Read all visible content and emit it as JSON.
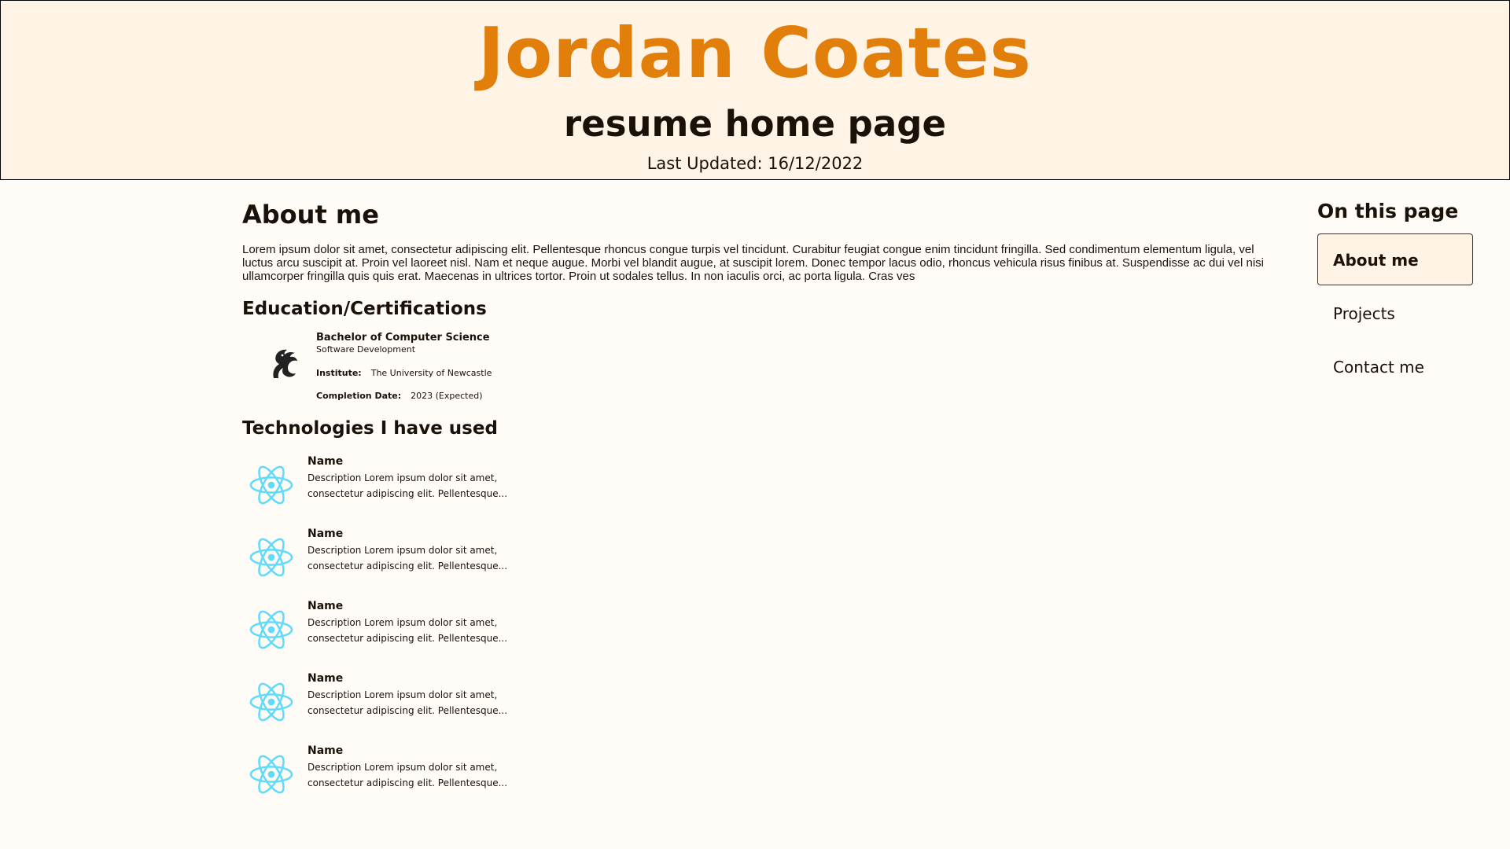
{
  "header": {
    "name": "Jordan Coates",
    "subtitle": "resume home page",
    "last_updated": "Last Updated: 16/12/2022"
  },
  "about": {
    "heading": "About me",
    "text": "Lorem ipsum dolor sit amet, consectetur adipiscing elit. Pellentesque rhoncus congue turpis vel tincidunt. Curabitur feugiat congue enim tincidunt fringilla. Sed condimentum elementum ligula, vel luctus arcu suscipit at. Proin vel laoreet nisl. Nam et neque augue. Morbi vel blandit augue, at suscipit lorem. Donec tempor lacus odio, rhoncus vehicula risus finibus at. Suspendisse ac dui vel nisi ullamcorper fringilla quis quis erat. Maecenas in ultrices tortor. Proin ut sodales tellus. In non iaculis orci, ac porta ligula. Cras ves"
  },
  "education": {
    "heading": "Education/Certifications",
    "logo_icon": "university-seahorse-logo",
    "degree": "Bachelor of Computer Science",
    "major": "Software Development",
    "institute_label": "Institute:",
    "institute": "The University of Newcastle",
    "completion_label": "Completion Date:",
    "completion": "2023 (Expected)"
  },
  "technologies": {
    "heading": "Technologies I have used",
    "icon": "react-atom-icon",
    "icon_color": "#61dafb",
    "items": [
      {
        "name": "Name",
        "description": "Description Lorem ipsum dolor sit amet, consectetur adipiscing elit. Pellentesque..."
      },
      {
        "name": "Name",
        "description": "Description Lorem ipsum dolor sit amet, consectetur adipiscing elit. Pellentesque..."
      },
      {
        "name": "Name",
        "description": "Description Lorem ipsum dolor sit amet, consectetur adipiscing elit. Pellentesque..."
      },
      {
        "name": "Name",
        "description": "Description Lorem ipsum dolor sit amet, consectetur adipiscing elit. Pellentesque..."
      },
      {
        "name": "Name",
        "description": "Description Lorem ipsum dolor sit amet, consectetur adipiscing elit. Pellentesque..."
      }
    ]
  },
  "toc": {
    "title": "On this page",
    "items": [
      {
        "label": "About me",
        "active": true
      },
      {
        "label": "Projects",
        "active": false
      },
      {
        "label": "Contact me",
        "active": false
      }
    ]
  },
  "colors": {
    "accent": "#e17f0a",
    "header_bg": "#fff3e6",
    "page_bg": "#fffcf8"
  }
}
